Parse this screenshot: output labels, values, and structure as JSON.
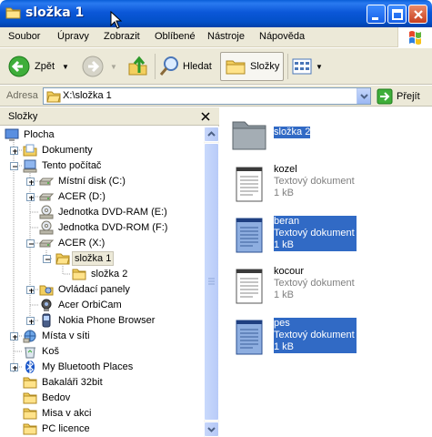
{
  "window": {
    "title": "složka 1"
  },
  "menu": [
    "Soubor",
    "Úpravy",
    "Zobrazit",
    "Oblíbené",
    "Nástroje",
    "Nápověda"
  ],
  "toolbar": {
    "back": "Zpět",
    "search": "Hledat",
    "folders": "Složky"
  },
  "address": {
    "label": "Adresa",
    "value": "X:\\složka 1",
    "go": "Přejít"
  },
  "panel": {
    "title": "Složky"
  },
  "tree": [
    {
      "label": "Plocha",
      "icon": "desktop-icon"
    },
    {
      "label": "Dokumenty",
      "icon": "documents-icon"
    },
    {
      "label": "Tento počítač",
      "icon": "computer-icon"
    },
    {
      "label": "Místní disk (C:)",
      "icon": "hard-drive-icon"
    },
    {
      "label": "ACER (D:)",
      "icon": "hard-drive-icon"
    },
    {
      "label": "Jednotka DVD-RAM (E:)",
      "icon": "dvd-drive-icon"
    },
    {
      "label": "Jednotka DVD-ROM (F:)",
      "icon": "dvd-drive-icon"
    },
    {
      "label": "ACER (X:)",
      "icon": "hard-drive-icon"
    },
    {
      "label": "složka 1",
      "icon": "open-folder-icon"
    },
    {
      "label": "složka 2",
      "icon": "folder-icon"
    },
    {
      "label": "Ovládací panely",
      "icon": "control-panel-icon"
    },
    {
      "label": "Acer OrbiCam",
      "icon": "camera-icon"
    },
    {
      "label": "Nokia Phone Browser",
      "icon": "phone-icon"
    },
    {
      "label": "Místa v síti",
      "icon": "network-icon"
    },
    {
      "label": "Koš",
      "icon": "recycle-bin-icon"
    },
    {
      "label": "My Bluetooth Places",
      "icon": "bluetooth-icon"
    },
    {
      "label": "Bakaláři 32bit",
      "icon": "folder-icon"
    },
    {
      "label": "Bedov",
      "icon": "folder-icon"
    },
    {
      "label": "Misa v akci",
      "icon": "folder-icon"
    },
    {
      "label": "PC licence",
      "icon": "folder-icon"
    }
  ],
  "files": [
    {
      "name": "složka 2",
      "type": "",
      "size": "",
      "selected": true,
      "kind": "folder"
    },
    {
      "name": "kozel",
      "type": "Textový dokument",
      "size": "1 kB",
      "selected": false,
      "kind": "text"
    },
    {
      "name": "beran",
      "type": "Textový dokument",
      "size": "1 kB",
      "selected": true,
      "kind": "text"
    },
    {
      "name": "kocour",
      "type": "Textový dokument",
      "size": "1 kB",
      "selected": false,
      "kind": "text"
    },
    {
      "name": "pes",
      "type": "Textový dokument",
      "size": "1 kB",
      "selected": true,
      "kind": "text"
    }
  ],
  "colors": {
    "title_blue": "#0b57d8",
    "selection": "#316ac5",
    "chrome": "#ece9d8"
  }
}
